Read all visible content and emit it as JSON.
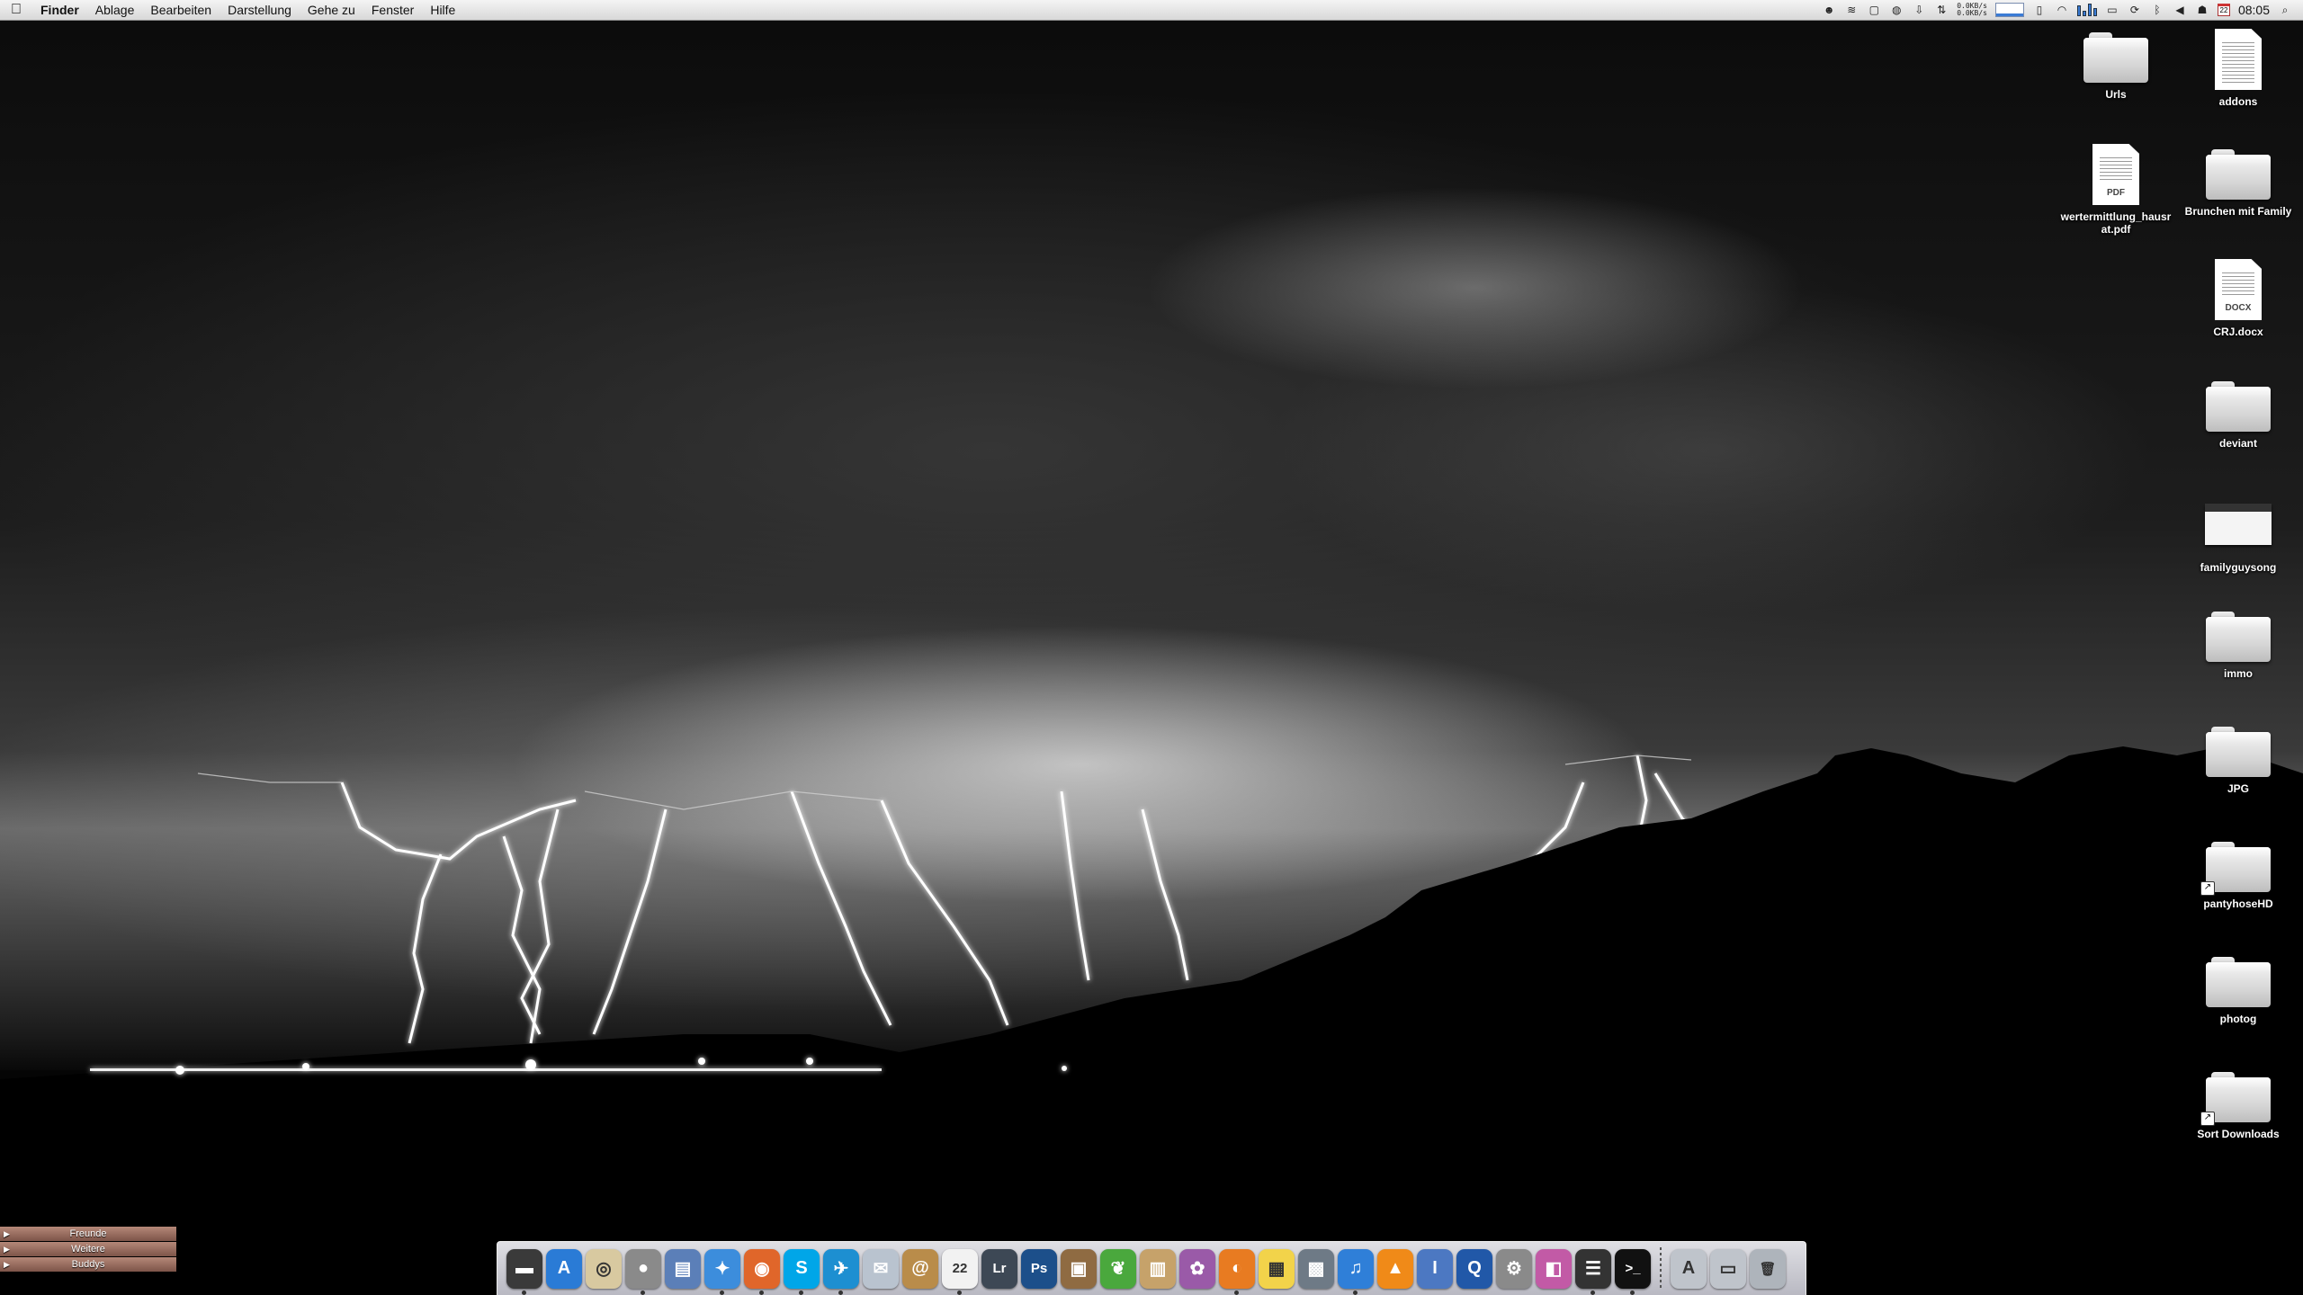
{
  "menubar": {
    "apple_icon": "apple-icon",
    "app_name": "Finder",
    "items": [
      "Ablage",
      "Bearbeiten",
      "Darstellung",
      "Gehe zu",
      "Fenster",
      "Hilfe"
    ],
    "net_up": "0.0KB/s",
    "net_down": "0.0KB/s",
    "calendar_day": "22",
    "clock": "08:05"
  },
  "desktop": {
    "icons": [
      {
        "label": "Urls",
        "kind": "folder"
      },
      {
        "label": "addons",
        "kind": "document"
      },
      {
        "label": "wertermittlung_hausrat.pdf",
        "kind": "pdf",
        "tag": "PDF"
      },
      {
        "label": "Brunchen mit Family",
        "kind": "folder"
      },
      {
        "label": "CRJ.docx",
        "kind": "docx",
        "tag": "DOCX"
      },
      {
        "label": "deviant",
        "kind": "folder"
      },
      {
        "label": "familyguysong",
        "kind": "image"
      },
      {
        "label": "immo",
        "kind": "folder"
      },
      {
        "label": "JPG",
        "kind": "folder"
      },
      {
        "label": "pantyhoseHD",
        "kind": "folder-alias"
      },
      {
        "label": "photog",
        "kind": "folder"
      },
      {
        "label": "Sort Downloads",
        "kind": "folder-alias"
      }
    ]
  },
  "buddy_list": {
    "groups": [
      "Freunde",
      "Weitere",
      "Buddys"
    ]
  },
  "dock": {
    "items": [
      {
        "name": "screen-icon",
        "bg": "#3a3a3a",
        "glyph": "▬"
      },
      {
        "name": "app-store-icon",
        "bg": "#2a7bd6",
        "glyph": "A"
      },
      {
        "name": "shell-icon",
        "bg": "#d8c9a0",
        "glyph": "◎"
      },
      {
        "name": "totoro-icon",
        "bg": "#8a8a8a",
        "glyph": "●"
      },
      {
        "name": "preview-icon",
        "bg": "#5b7fb8",
        "glyph": "▤"
      },
      {
        "name": "safari-icon",
        "bg": "#3c8ddc",
        "glyph": "✦"
      },
      {
        "name": "firefox-icon",
        "bg": "#e0662a",
        "glyph": "◉"
      },
      {
        "name": "skype-icon",
        "bg": "#00a6e8",
        "glyph": "S"
      },
      {
        "name": "twitter-icon",
        "bg": "#1d8fd1",
        "glyph": "✈"
      },
      {
        "name": "mail-icon",
        "bg": "#b9c3cf",
        "glyph": "✉"
      },
      {
        "name": "address-book-icon",
        "bg": "#b98c4a",
        "glyph": "@"
      },
      {
        "name": "ical-icon",
        "bg": "#f2f2f2",
        "glyph": "22"
      },
      {
        "name": "lightroom-icon",
        "bg": "#3d4855",
        "glyph": "Lr"
      },
      {
        "name": "photoshop-icon",
        "bg": "#1c4f8a",
        "glyph": "Ps"
      },
      {
        "name": "iphoto-icon",
        "bg": "#8f6b42",
        "glyph": "▣"
      },
      {
        "name": "leaf-icon",
        "bg": "#4aa83d",
        "glyph": "❦"
      },
      {
        "name": "archive-icon",
        "bg": "#c6a26a",
        "glyph": "▥"
      },
      {
        "name": "aperture-icon",
        "bg": "#9a5aa8",
        "glyph": "✿"
      },
      {
        "name": "instruments-icon",
        "bg": "#e87b21",
        "glyph": "◐"
      },
      {
        "name": "stickies-icon",
        "bg": "#f2d34a",
        "glyph": "▦"
      },
      {
        "name": "image-capture-icon",
        "bg": "#6e7a86",
        "glyph": "▩"
      },
      {
        "name": "itunes-icon",
        "bg": "#2f7fd8",
        "glyph": "♫"
      },
      {
        "name": "vlc-icon",
        "bg": "#f08a18",
        "glyph": "▲"
      },
      {
        "name": "utility-icon",
        "bg": "#4c78c2",
        "glyph": "I"
      },
      {
        "name": "quicktime-icon",
        "bg": "#2158a8",
        "glyph": "Q"
      },
      {
        "name": "system-prefs-icon",
        "bg": "#8a8a8a",
        "glyph": "⚙"
      },
      {
        "name": "photo-booth-icon",
        "bg": "#c25aa6",
        "glyph": "◧"
      },
      {
        "name": "clapper-icon",
        "bg": "#333333",
        "glyph": "☰"
      },
      {
        "name": "terminal-icon",
        "bg": "#111111",
        "glyph": ">_"
      },
      {
        "name": "applications-folder-icon",
        "bg": "#bfc4cb",
        "glyph": "A"
      },
      {
        "name": "downloads-stack-icon",
        "bg": "#bfc4cb",
        "glyph": "▭"
      },
      {
        "name": "trash-icon",
        "bg": "#aeb4bb",
        "glyph": "🗑"
      }
    ]
  }
}
